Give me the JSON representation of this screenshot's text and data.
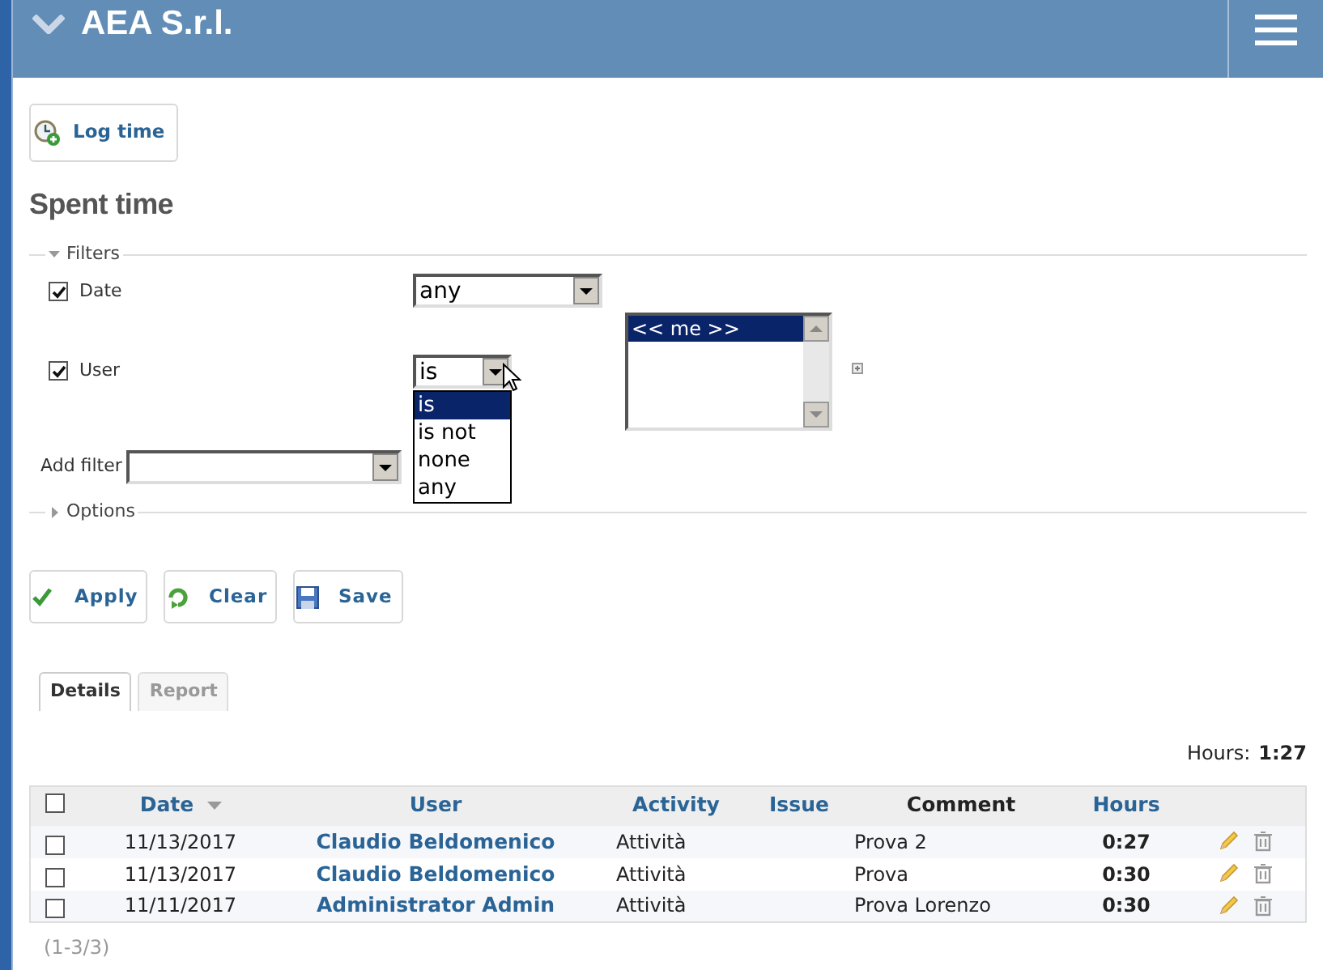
{
  "header": {
    "title": "AEA S.r.l."
  },
  "log_time_button": "Log time",
  "heading": "Spent time",
  "filters": {
    "legend": "Filters",
    "expanded": true,
    "rows": [
      {
        "label": "Date",
        "checked": true,
        "operator": "any"
      },
      {
        "label": "User",
        "checked": true,
        "operator": "is",
        "open": true,
        "operator_options": [
          {
            "label": "is",
            "selected": true
          },
          {
            "label": "is not",
            "selected": false
          },
          {
            "label": "none",
            "selected": false
          },
          {
            "label": "any",
            "selected": false
          }
        ],
        "values": [
          {
            "label": "<< me >>",
            "selected": true
          }
        ]
      }
    ],
    "add_filter_label": "Add filter"
  },
  "options": {
    "legend": "Options",
    "expanded": false
  },
  "buttons": [
    {
      "kind": "apply",
      "label": "Apply"
    },
    {
      "kind": "clear",
      "label": "Clear"
    },
    {
      "kind": "save",
      "label": "Save"
    }
  ],
  "tabs": [
    {
      "label": "Details",
      "selected": true
    },
    {
      "label": "Report",
      "selected": false
    }
  ],
  "total": {
    "label": "Hours:",
    "value": "1:27"
  },
  "table": {
    "select_all_checked": false,
    "columns": [
      {
        "label": "Date",
        "link": true,
        "sorted": true
      },
      {
        "label": "User",
        "link": true,
        "sorted": false
      },
      {
        "label": "Activity",
        "link": true,
        "sorted": false
      },
      {
        "label": "Issue",
        "link": true,
        "sorted": false
      },
      {
        "label": "Comment",
        "link": false,
        "sorted": false
      },
      {
        "label": "Hours",
        "link": true,
        "sorted": false
      }
    ],
    "rows": [
      {
        "checked": false,
        "date": "11/13/2017",
        "user": "Claudio Beldomenico",
        "activity": "Attività",
        "comment": "Prova 2",
        "hours": "0:27"
      },
      {
        "checked": false,
        "date": "11/13/2017",
        "user": "Claudio Beldomenico",
        "activity": "Attività",
        "comment": "Prova",
        "hours": "0:30"
      },
      {
        "checked": false,
        "date": "11/11/2017",
        "user": "Administrator Admin",
        "activity": "Attività",
        "comment": "Prova Lorenzo",
        "hours": "0:30"
      }
    ]
  },
  "pagination": "(1-3/3)"
}
